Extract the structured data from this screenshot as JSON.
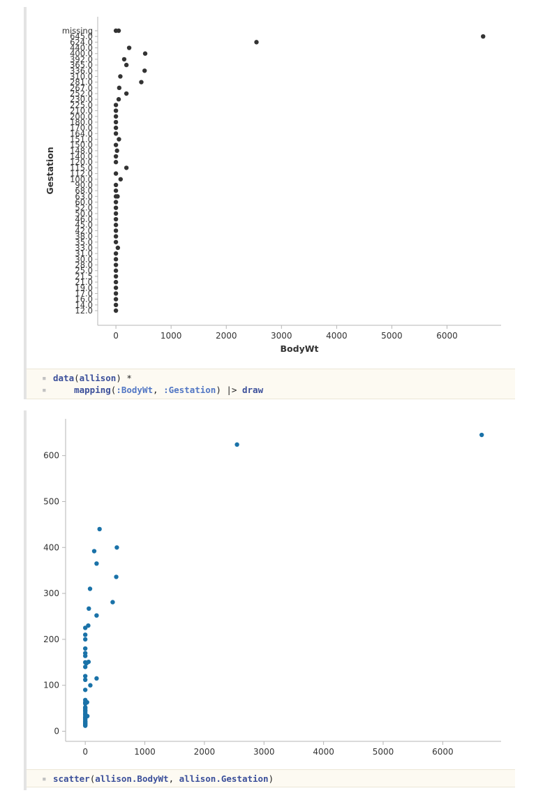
{
  "colors": {
    "dot1": "#333333",
    "dot2": "#1a72a8",
    "axis": "#b5b5b5"
  },
  "code1": {
    "line1": {
      "fn": "data",
      "open": "(",
      "arg": "allison",
      "close": ") *"
    },
    "line2": {
      "fn": "mapping",
      "open": "(",
      "arg1": ":BodyWt",
      "sep": ", ",
      "arg2": ":Gestation",
      "close": ") ",
      "pipe": "|>",
      "space": " ",
      "fn2": "draw"
    }
  },
  "code2": {
    "line1": {
      "fn": "scatter",
      "open": "(",
      "arg1": "allison.BodyWt",
      "sep": ", ",
      "arg2": "allison.Gestation",
      "close": ")"
    }
  },
  "chart_data": [
    {
      "type": "scatter",
      "xlabel": "BodyWt",
      "ylabel": "Gestation",
      "xlim": [
        -330,
        6980
      ],
      "xticks": [
        0,
        1000,
        2000,
        3000,
        4000,
        5000,
        6000
      ],
      "categories": [
        "12.0",
        "14.0",
        "16.0",
        "17.0",
        "19.0",
        "21.0",
        "21.5",
        "25.0",
        "28.0",
        "30.0",
        "31.0",
        "33.0",
        "35.0",
        "38.0",
        "42.0",
        "45.0",
        "46.0",
        "50.0",
        "52.0",
        "60.0",
        "63.0",
        "68.0",
        "90.0",
        "100.0",
        "112.0",
        "115.0",
        "120.0",
        "140.0",
        "148.0",
        "150.0",
        "151.0",
        "164.0",
        "170.0",
        "180.0",
        "200.0",
        "210.0",
        "225.0",
        "230.0",
        "252.0",
        "267.0",
        "281.0",
        "310.0",
        "336.0",
        "365.0",
        "392.0",
        "400.0",
        "440.0",
        "624.0",
        "645.0",
        "missing"
      ],
      "points": [
        {
          "x": 0,
          "y": "12.0"
        },
        {
          "x": 0,
          "y": "14.0"
        },
        {
          "x": 0,
          "y": "16.0"
        },
        {
          "x": 0,
          "y": "17.0"
        },
        {
          "x": 0,
          "y": "19.0"
        },
        {
          "x": 0,
          "y": "21.0"
        },
        {
          "x": 0,
          "y": "21.5"
        },
        {
          "x": 0,
          "y": "25.0"
        },
        {
          "x": 0,
          "y": "28.0"
        },
        {
          "x": 0,
          "y": "30.0"
        },
        {
          "x": 0,
          "y": "31.0"
        },
        {
          "x": 35,
          "y": "33.0"
        },
        {
          "x": 0,
          "y": "35.0"
        },
        {
          "x": 0,
          "y": "38.0"
        },
        {
          "x": 0,
          "y": "42.0"
        },
        {
          "x": 0,
          "y": "45.0"
        },
        {
          "x": 0,
          "y": "46.0"
        },
        {
          "x": 0,
          "y": "50.0"
        },
        {
          "x": 0,
          "y": "52.0"
        },
        {
          "x": 0,
          "y": "60.0"
        },
        {
          "x": 0,
          "y": "63.0"
        },
        {
          "x": 30,
          "y": "63.0"
        },
        {
          "x": 0,
          "y": "68.0"
        },
        {
          "x": 0,
          "y": "90.0"
        },
        {
          "x": 85,
          "y": "100.0"
        },
        {
          "x": 0,
          "y": "112.0"
        },
        {
          "x": 190,
          "y": "115.0"
        },
        {
          "x": 0,
          "y": "120.0"
        },
        {
          "x": 0,
          "y": "140.0"
        },
        {
          "x": 20,
          "y": "148.0"
        },
        {
          "x": 0,
          "y": "150.0"
        },
        {
          "x": 55,
          "y": "151.0"
        },
        {
          "x": 0,
          "y": "164.0"
        },
        {
          "x": 0,
          "y": "170.0"
        },
        {
          "x": 0,
          "y": "180.0"
        },
        {
          "x": 0,
          "y": "200.0"
        },
        {
          "x": 0,
          "y": "210.0"
        },
        {
          "x": 0,
          "y": "225.0"
        },
        {
          "x": 50,
          "y": "230.0"
        },
        {
          "x": 190,
          "y": "252.0"
        },
        {
          "x": 60,
          "y": "267.0"
        },
        {
          "x": 460,
          "y": "281.0"
        },
        {
          "x": 80,
          "y": "310.0"
        },
        {
          "x": 520,
          "y": "336.0"
        },
        {
          "x": 190,
          "y": "365.0"
        },
        {
          "x": 150,
          "y": "392.0"
        },
        {
          "x": 530,
          "y": "400.0"
        },
        {
          "x": 240,
          "y": "440.0"
        },
        {
          "x": 2547,
          "y": "624.0"
        },
        {
          "x": 6654,
          "y": "645.0"
        },
        {
          "x": 0,
          "y": "missing"
        },
        {
          "x": 50,
          "y": "missing"
        }
      ]
    },
    {
      "type": "scatter",
      "xlabel": "",
      "ylabel": "",
      "xlim": [
        -330,
        6980
      ],
      "ylim": [
        -22,
        680
      ],
      "xticks": [
        0,
        1000,
        2000,
        3000,
        4000,
        5000,
        6000
      ],
      "yticks": [
        0,
        100,
        200,
        300,
        400,
        500,
        600
      ],
      "points": [
        {
          "x": 0,
          "y": 12
        },
        {
          "x": 0,
          "y": 14
        },
        {
          "x": 0,
          "y": 16
        },
        {
          "x": 0,
          "y": 17
        },
        {
          "x": 0,
          "y": 19
        },
        {
          "x": 0,
          "y": 21
        },
        {
          "x": 0,
          "y": 21.5
        },
        {
          "x": 0,
          "y": 25
        },
        {
          "x": 0,
          "y": 28
        },
        {
          "x": 0,
          "y": 30
        },
        {
          "x": 0,
          "y": 31
        },
        {
          "x": 35,
          "y": 33
        },
        {
          "x": 0,
          "y": 35
        },
        {
          "x": 0,
          "y": 38
        },
        {
          "x": 0,
          "y": 42
        },
        {
          "x": 0,
          "y": 45
        },
        {
          "x": 0,
          "y": 46
        },
        {
          "x": 0,
          "y": 50
        },
        {
          "x": 0,
          "y": 52
        },
        {
          "x": 0,
          "y": 60
        },
        {
          "x": 0,
          "y": 63
        },
        {
          "x": 30,
          "y": 63
        },
        {
          "x": 0,
          "y": 68
        },
        {
          "x": 0,
          "y": 90
        },
        {
          "x": 85,
          "y": 100
        },
        {
          "x": 0,
          "y": 112
        },
        {
          "x": 190,
          "y": 115
        },
        {
          "x": 0,
          "y": 120
        },
        {
          "x": 0,
          "y": 140
        },
        {
          "x": 20,
          "y": 148
        },
        {
          "x": 0,
          "y": 150
        },
        {
          "x": 55,
          "y": 151
        },
        {
          "x": 0,
          "y": 164
        },
        {
          "x": 0,
          "y": 170
        },
        {
          "x": 0,
          "y": 180
        },
        {
          "x": 0,
          "y": 200
        },
        {
          "x": 0,
          "y": 210
        },
        {
          "x": 0,
          "y": 225
        },
        {
          "x": 50,
          "y": 230
        },
        {
          "x": 190,
          "y": 252
        },
        {
          "x": 60,
          "y": 267
        },
        {
          "x": 460,
          "y": 281
        },
        {
          "x": 80,
          "y": 310
        },
        {
          "x": 520,
          "y": 336
        },
        {
          "x": 190,
          "y": 365
        },
        {
          "x": 150,
          "y": 392
        },
        {
          "x": 530,
          "y": 400
        },
        {
          "x": 240,
          "y": 440
        },
        {
          "x": 2547,
          "y": 624
        },
        {
          "x": 6654,
          "y": 645
        }
      ]
    }
  ]
}
